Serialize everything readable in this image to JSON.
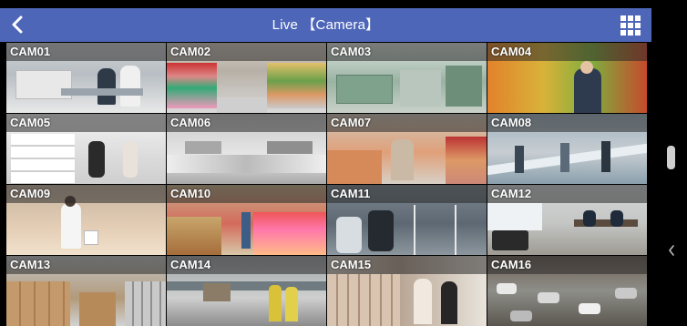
{
  "header": {
    "title": "Live 【Camera】",
    "back_icon": "chevron-left-icon",
    "layout_icon": "grid-view-icon",
    "bar_color": "#4e66b8"
  },
  "cameras": [
    {
      "label": "CAM01"
    },
    {
      "label": "CAM02"
    },
    {
      "label": "CAM03"
    },
    {
      "label": "CAM04"
    },
    {
      "label": "CAM05"
    },
    {
      "label": "CAM06"
    },
    {
      "label": "CAM07"
    },
    {
      "label": "CAM08"
    },
    {
      "label": "CAM09"
    },
    {
      "label": "CAM10"
    },
    {
      "label": "CAM11"
    },
    {
      "label": "CAM12"
    },
    {
      "label": "CAM13"
    },
    {
      "label": "CAM14"
    },
    {
      "label": "CAM15"
    },
    {
      "label": "CAM16"
    }
  ],
  "side_panel": {
    "handle_icon": "drag-handle-icon",
    "arrow_icon": "chevron-left-small-icon"
  }
}
